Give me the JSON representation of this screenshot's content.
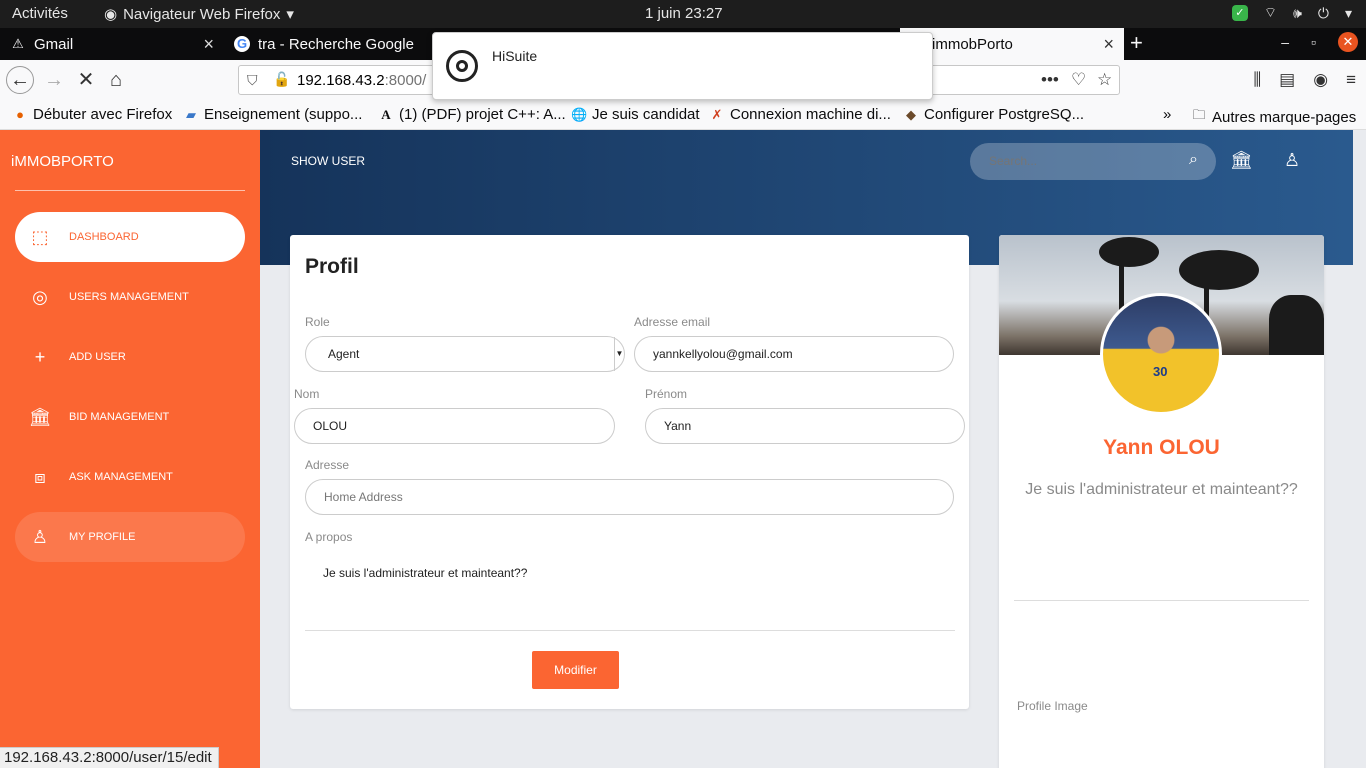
{
  "os": {
    "activities": "Activités",
    "app_name": "Navigateur Web Firefox",
    "clock": "1 juin  23:27"
  },
  "tabs": [
    {
      "label": "Gmail"
    },
    {
      "label": "tra - Recherche Google"
    },
    {
      "label": "immobPorto"
    }
  ],
  "url": {
    "host": "192.168.43.2",
    "port_path": ":8000/"
  },
  "bookmarks": [
    {
      "label": "Débuter avec Firefox"
    },
    {
      "label": "Enseignement (suppo..."
    },
    {
      "label": "(1) (PDF) projet C++: A..."
    },
    {
      "label": "Je suis candidat"
    },
    {
      "label": "Connexion machine di..."
    },
    {
      "label": "Configurer PostgreSQ..."
    },
    {
      "label": "Autres marque-pages"
    }
  ],
  "popup": {
    "title": "HiSuite"
  },
  "sidebar": {
    "brand": "iMMOBPORTO",
    "items": [
      {
        "label": "DASHBOARD"
      },
      {
        "label": "USERS MANAGEMENT"
      },
      {
        "label": "ADD USER"
      },
      {
        "label": "BID MANAGEMENT"
      },
      {
        "label": "ASK MANAGEMENT"
      },
      {
        "label": "MY PROFILE"
      }
    ]
  },
  "header": {
    "title": "SHOW USER",
    "search_placeholder": "Search..."
  },
  "form": {
    "title": "Profil",
    "role_label": "Role",
    "role_value": "Agent",
    "email_label": "Adresse email",
    "email_value": "yannkellyolou@gmail.com",
    "nom_label": "Nom",
    "nom_value": "OLOU",
    "prenom_label": "Prénom",
    "prenom_value": "Yann",
    "adresse_label": "Adresse",
    "adresse_placeholder": "Home Address",
    "apropos_label": "A propos",
    "apropos_value": "Je suis l'administrateur et mainteant??",
    "submit": "Modifier"
  },
  "profile": {
    "jersey_number": "30",
    "name": "Yann OLOU",
    "description": "Je suis l'administrateur et mainteant??",
    "image_label": "Profile Image"
  },
  "status_url": "192.168.43.2:8000/user/15/edit"
}
